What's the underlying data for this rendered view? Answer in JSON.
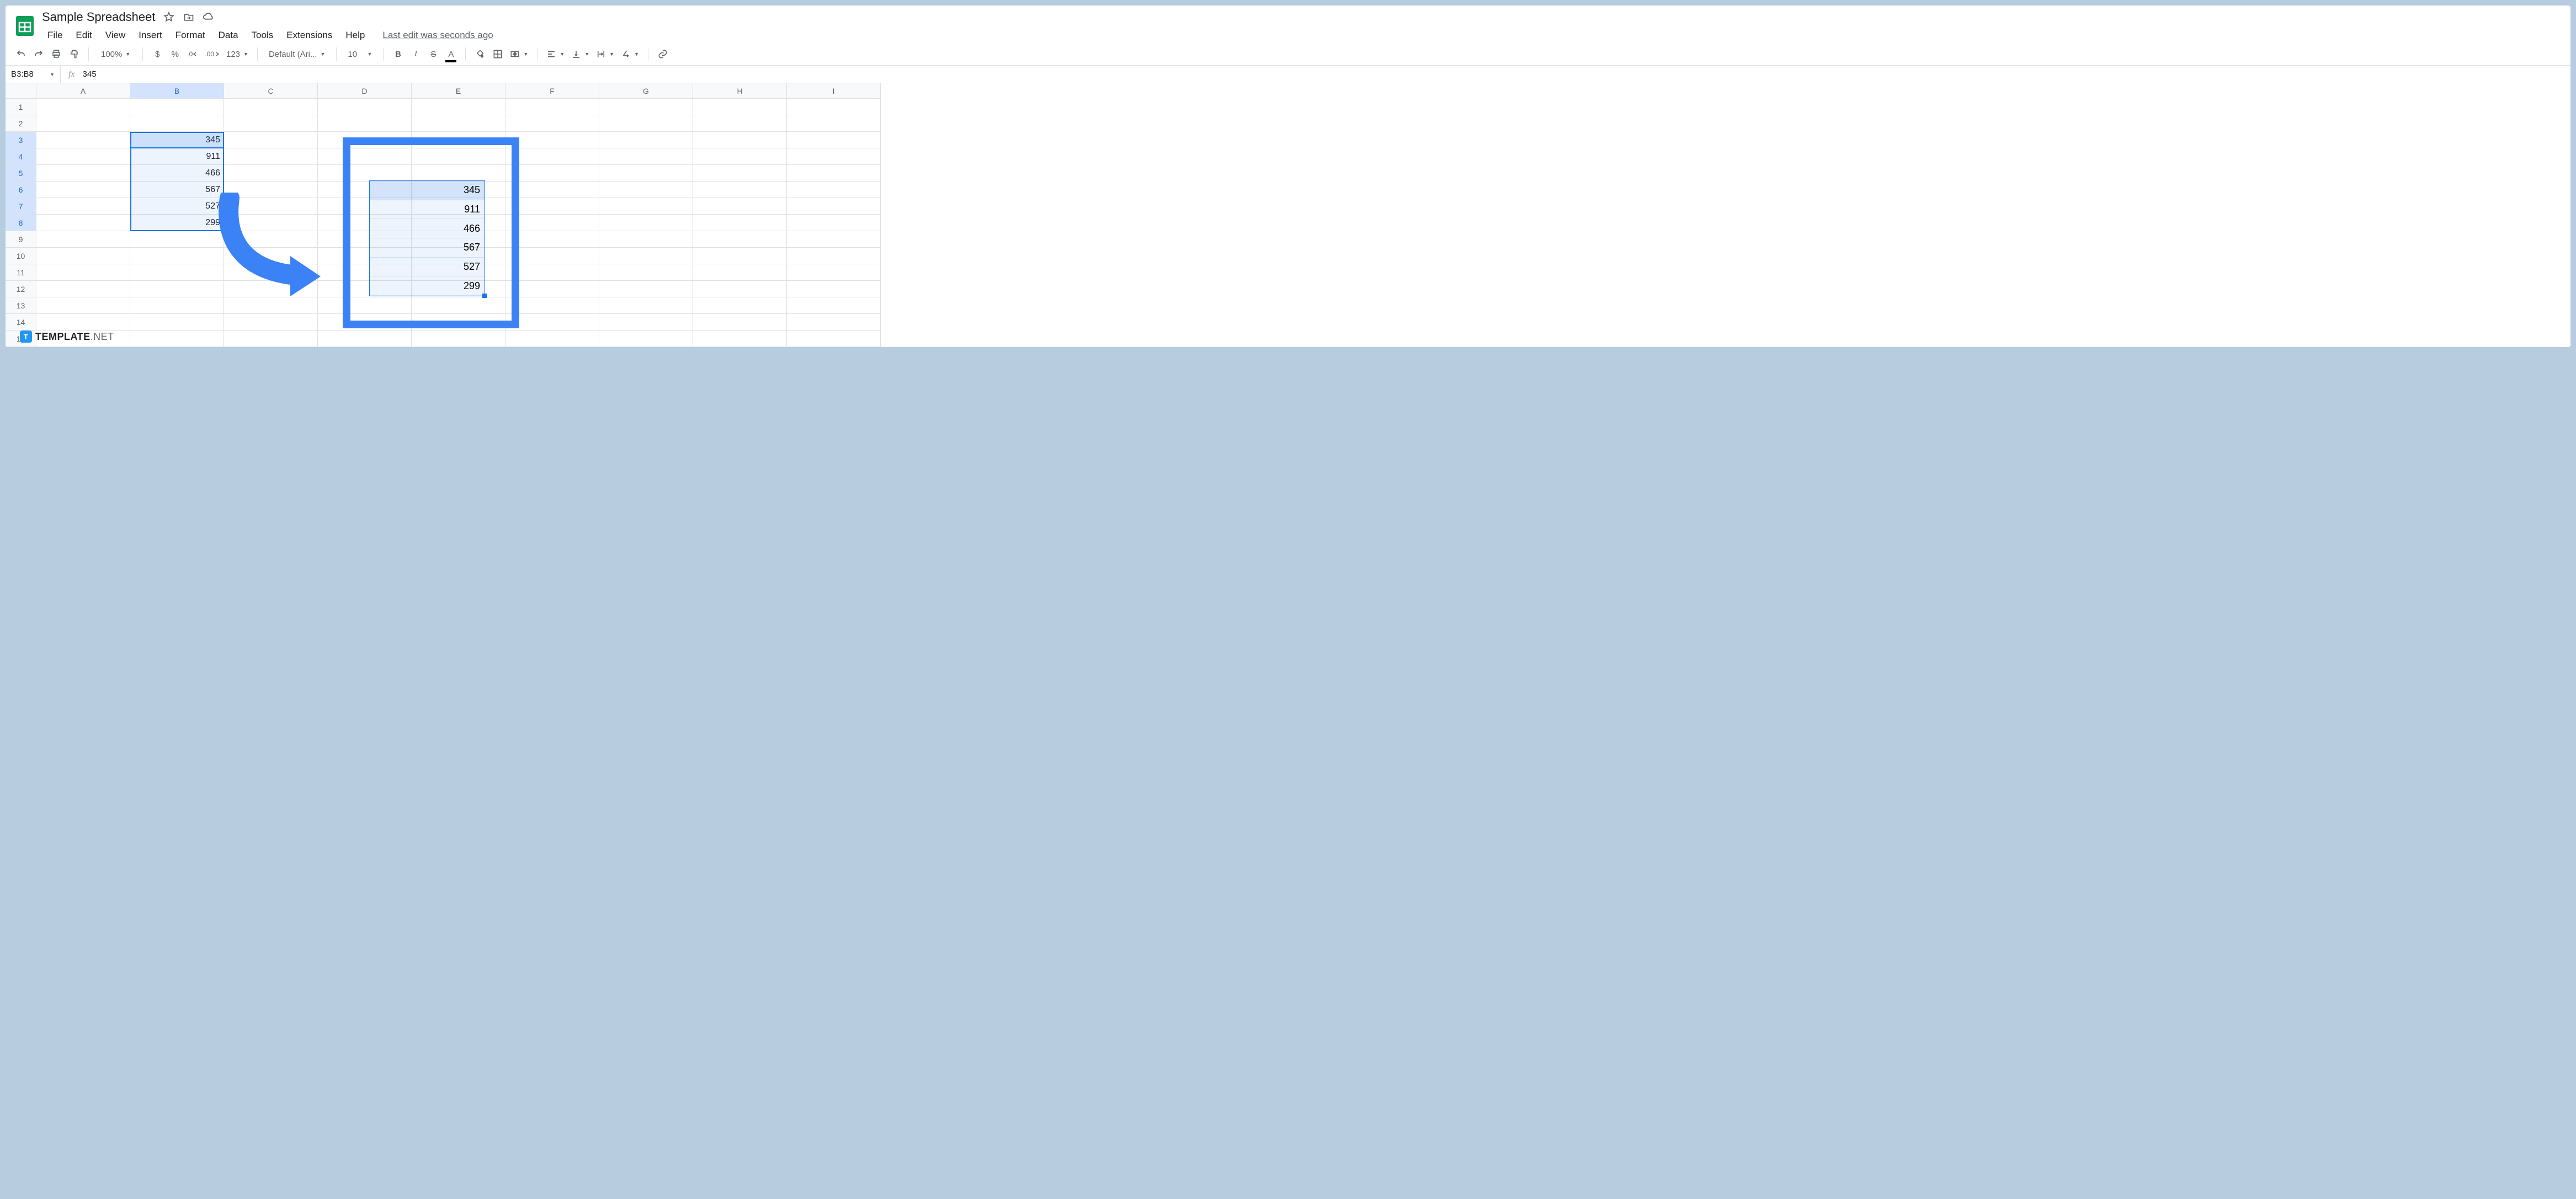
{
  "doc": {
    "title": "Sample Spreadsheet"
  },
  "menu": {
    "file": "File",
    "edit": "Edit",
    "view": "View",
    "insert": "Insert",
    "format": "Format",
    "data": "Data",
    "tools": "Tools",
    "extensions": "Extensions",
    "help": "Help",
    "last_edit": "Last edit was seconds ago"
  },
  "toolbar": {
    "zoom": "100%",
    "currency": "$",
    "percent": "%",
    "dec_dec": ".0",
    "inc_dec": ".00",
    "num_fmt": "123",
    "font": "Default (Ari...",
    "size": "10"
  },
  "name_box": "B3:B8",
  "formula_bar": "345",
  "columns": [
    "A",
    "B",
    "C",
    "D",
    "E",
    "F",
    "G",
    "H",
    "I"
  ],
  "rows": [
    1,
    2,
    3,
    4,
    5,
    6,
    7,
    8,
    9,
    10,
    11,
    12,
    13,
    14,
    15
  ],
  "cells": {
    "B3": "345",
    "B4": "911",
    "B5": "466",
    "B6": "567",
    "B7": "527",
    "B8": "299"
  },
  "copy_values": [
    "345",
    "911",
    "466",
    "567",
    "527",
    "299"
  ],
  "watermark": {
    "brand": "TEMPLATE",
    "suffix": ".NET"
  }
}
